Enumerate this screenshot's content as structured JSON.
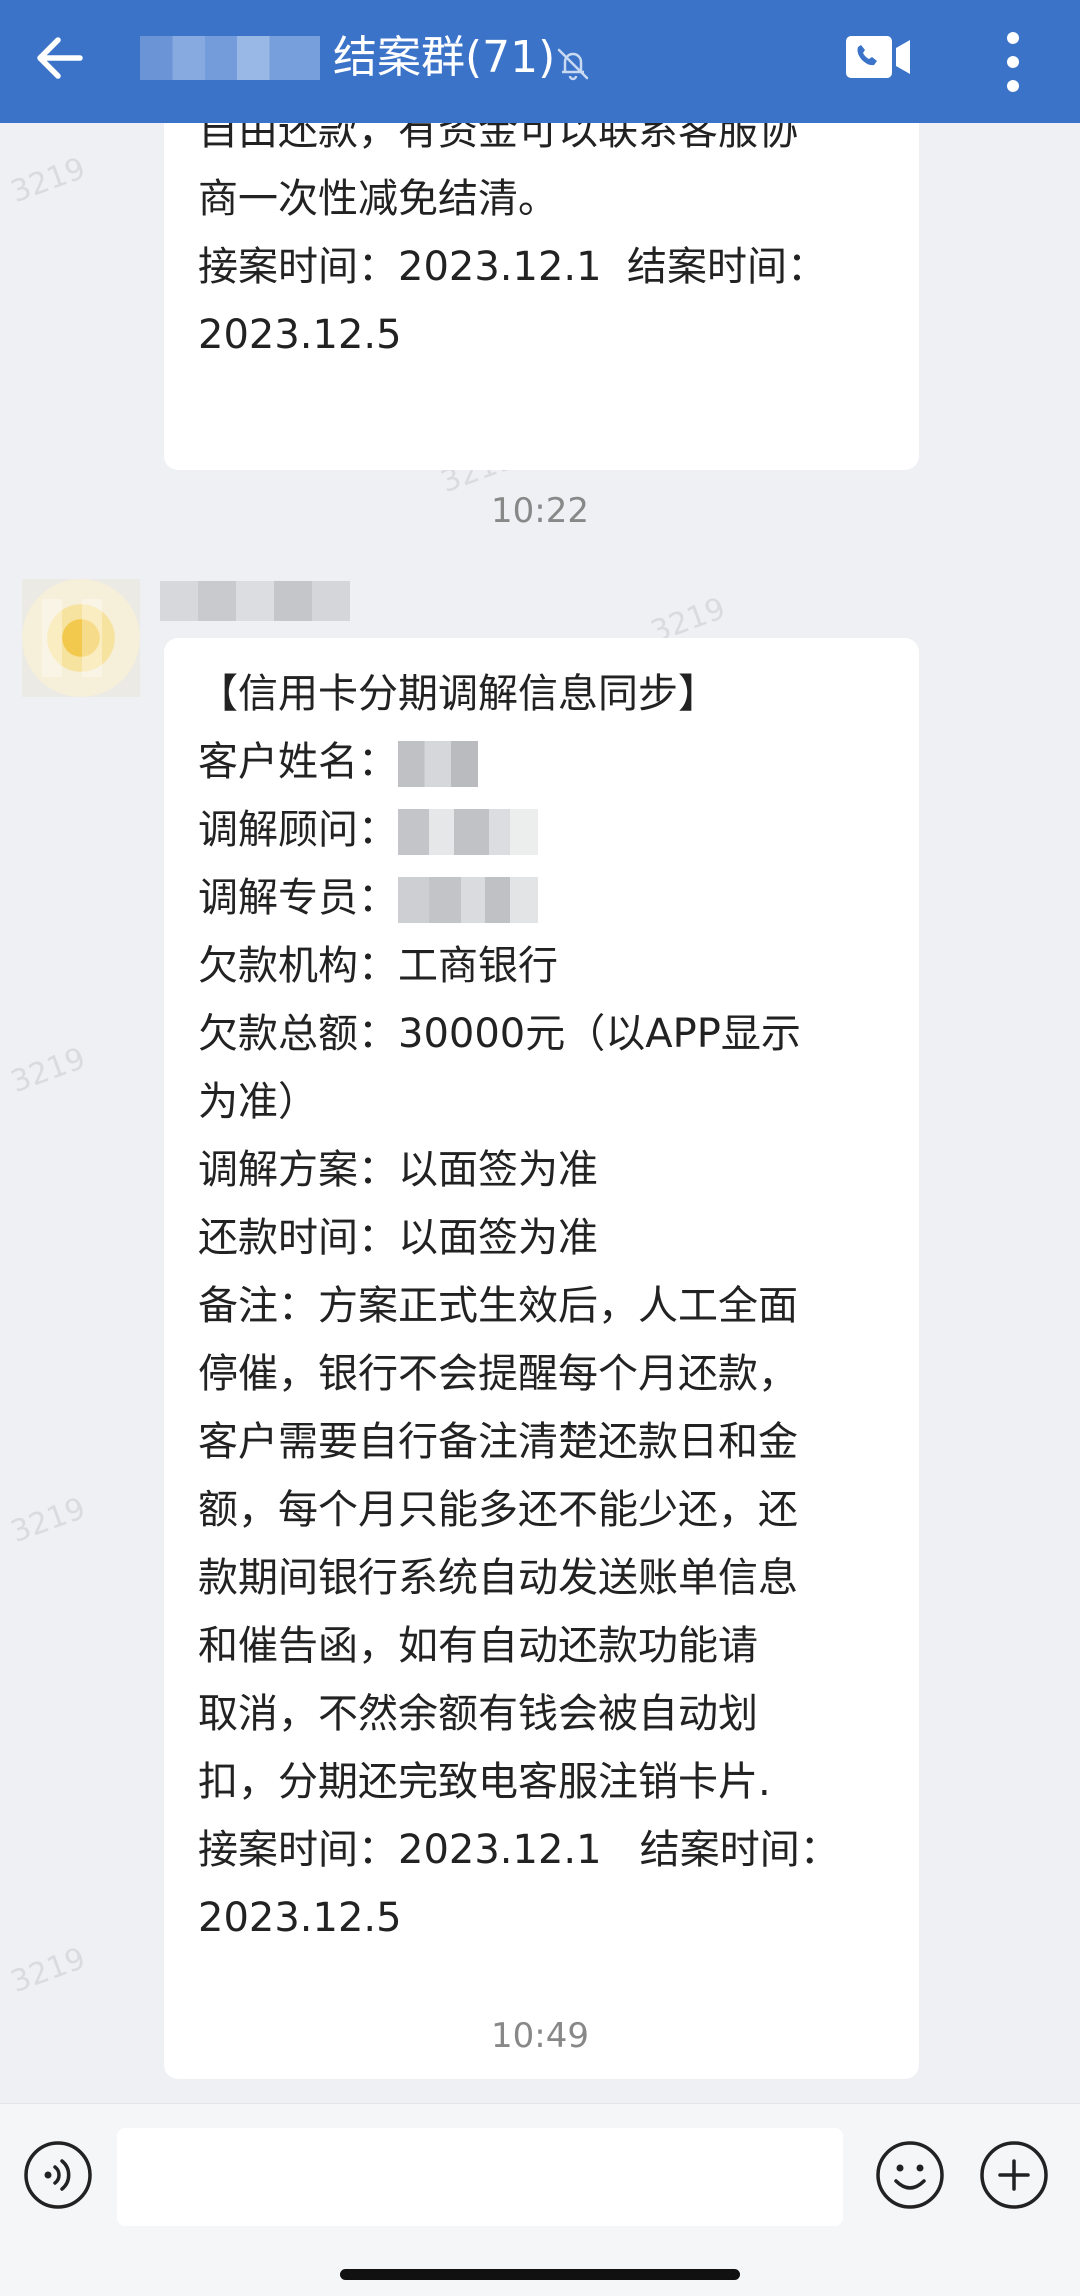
{
  "header": {
    "title": "结案群(71)",
    "bg_color": "#3b73c9",
    "icons": [
      "back-arrow-icon",
      "mute-bell-icon",
      "video-call-icon",
      "more-vert-icon"
    ]
  },
  "messages": [
    {
      "lines": [
        "自由还款，有资金可以联系客服协",
        "商一次性减免结清。",
        "接案时间：2023.12.1  结案时间：",
        "2023.12.5"
      ]
    },
    {
      "time": "10:22"
    },
    {
      "title": "【信用卡分期调解信息同步】",
      "customer_label": "客户姓名：",
      "advisor_label": "调解顾问：",
      "specialist_label": "调解专员：",
      "lines": [
        "欠款机构：工商银行",
        "欠款总额：30000元（以APP显示",
        "为准）",
        "调解方案：以面签为准",
        "还款时间：以面签为准",
        "备注：方案正式生效后，人工全面",
        "停催，银行不会提醒每个月还款，",
        "客户需要自行备注清楚还款日和金",
        "额，每个月只能多还不能少还，还",
        "款期间银行系统自动发送账单信息",
        "和催告函，如有自动还款功能请",
        "取消，不然余额有钱会被自动划",
        "扣，分期还完致电客服注销卡片.",
        "接案时间：2023.12.1   结案时间：",
        "2023.12.5"
      ]
    },
    {
      "time": "10:49"
    }
  ],
  "watermark": "3219",
  "input": {
    "value": "",
    "icons": [
      "voice-icon",
      "emoji-icon",
      "plus-icon"
    ]
  }
}
